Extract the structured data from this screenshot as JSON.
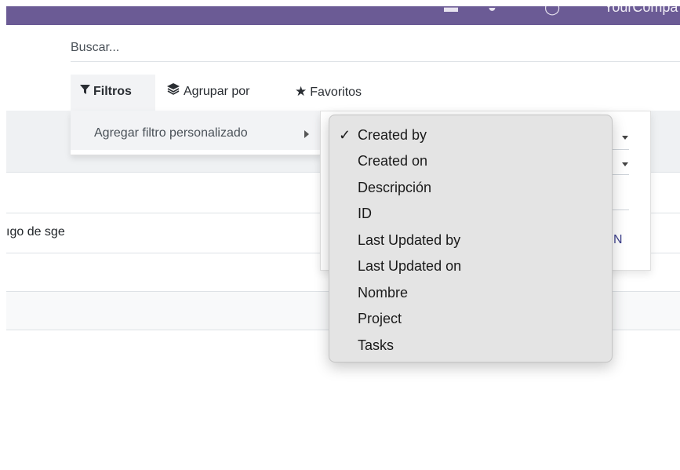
{
  "top_bar": {
    "company_text": "YourCompa",
    "colors": {
      "background": "#6b5b95"
    }
  },
  "search": {
    "placeholder": "Buscar..."
  },
  "filter_bar": {
    "filtros_label": "Filtros",
    "agrupar_label": "Agrupar por",
    "favoritos_label": "Favoritos"
  },
  "filters_dropdown": {
    "custom_filter_label": "Agregar filtro personalizado"
  },
  "list": {
    "row_text": "ıgo de sge"
  },
  "custom_filter_panel": {
    "apply_partial": "N"
  },
  "field_select": {
    "selected": "Created by",
    "options": [
      "Created by",
      "Created on",
      "Descripción",
      "ID",
      "Last Updated by",
      "Last Updated on",
      "Nombre",
      "Project",
      "Tasks"
    ]
  }
}
